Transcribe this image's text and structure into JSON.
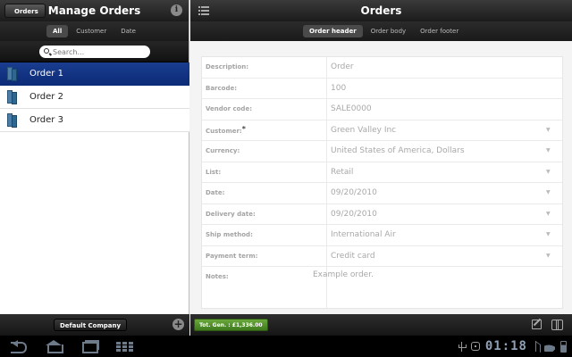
{
  "left": {
    "back_label": "Orders",
    "title": "Manage Orders",
    "filters": [
      {
        "label": "All",
        "active": true
      },
      {
        "label": "Customer",
        "active": false
      },
      {
        "label": "Date",
        "active": false
      }
    ],
    "search_placeholder": "Search...",
    "items": [
      {
        "label": "Order 1",
        "selected": true
      },
      {
        "label": "Order 2",
        "selected": false
      },
      {
        "label": "Order 3",
        "selected": false
      }
    ],
    "company_button": "Default Company"
  },
  "right": {
    "title": "Orders",
    "tabs": [
      {
        "label": "Order header",
        "active": true
      },
      {
        "label": "Order body",
        "active": false
      },
      {
        "label": "Order footer",
        "active": false
      }
    ],
    "fields": [
      {
        "label": "Description:",
        "value": "Order",
        "dropdown": false
      },
      {
        "label": "Barcode:",
        "value": "100",
        "dropdown": false
      },
      {
        "label": "Vendor code:",
        "value": "SALE0000",
        "dropdown": false
      },
      {
        "label": "Customer:",
        "value": "Green Valley Inc",
        "dropdown": true,
        "required": true
      },
      {
        "label": "Currency:",
        "value": "United States of America, Dollars",
        "dropdown": true
      },
      {
        "label": "List:",
        "value": "Retail",
        "dropdown": true
      },
      {
        "label": "Date:",
        "value": "09/20/2010",
        "dropdown": true
      },
      {
        "label": "Delivery date:",
        "value": "09/20/2010",
        "dropdown": true
      },
      {
        "label": "Ship method:",
        "value": "International Air",
        "dropdown": true
      },
      {
        "label": "Payment term:",
        "value": "Credit card",
        "dropdown": true
      }
    ],
    "notes_label": "Notes:",
    "notes_value": "Example order.",
    "total_badge": "Tot. Gen. : £1,336.00"
  },
  "system": {
    "clock": "01:18"
  }
}
